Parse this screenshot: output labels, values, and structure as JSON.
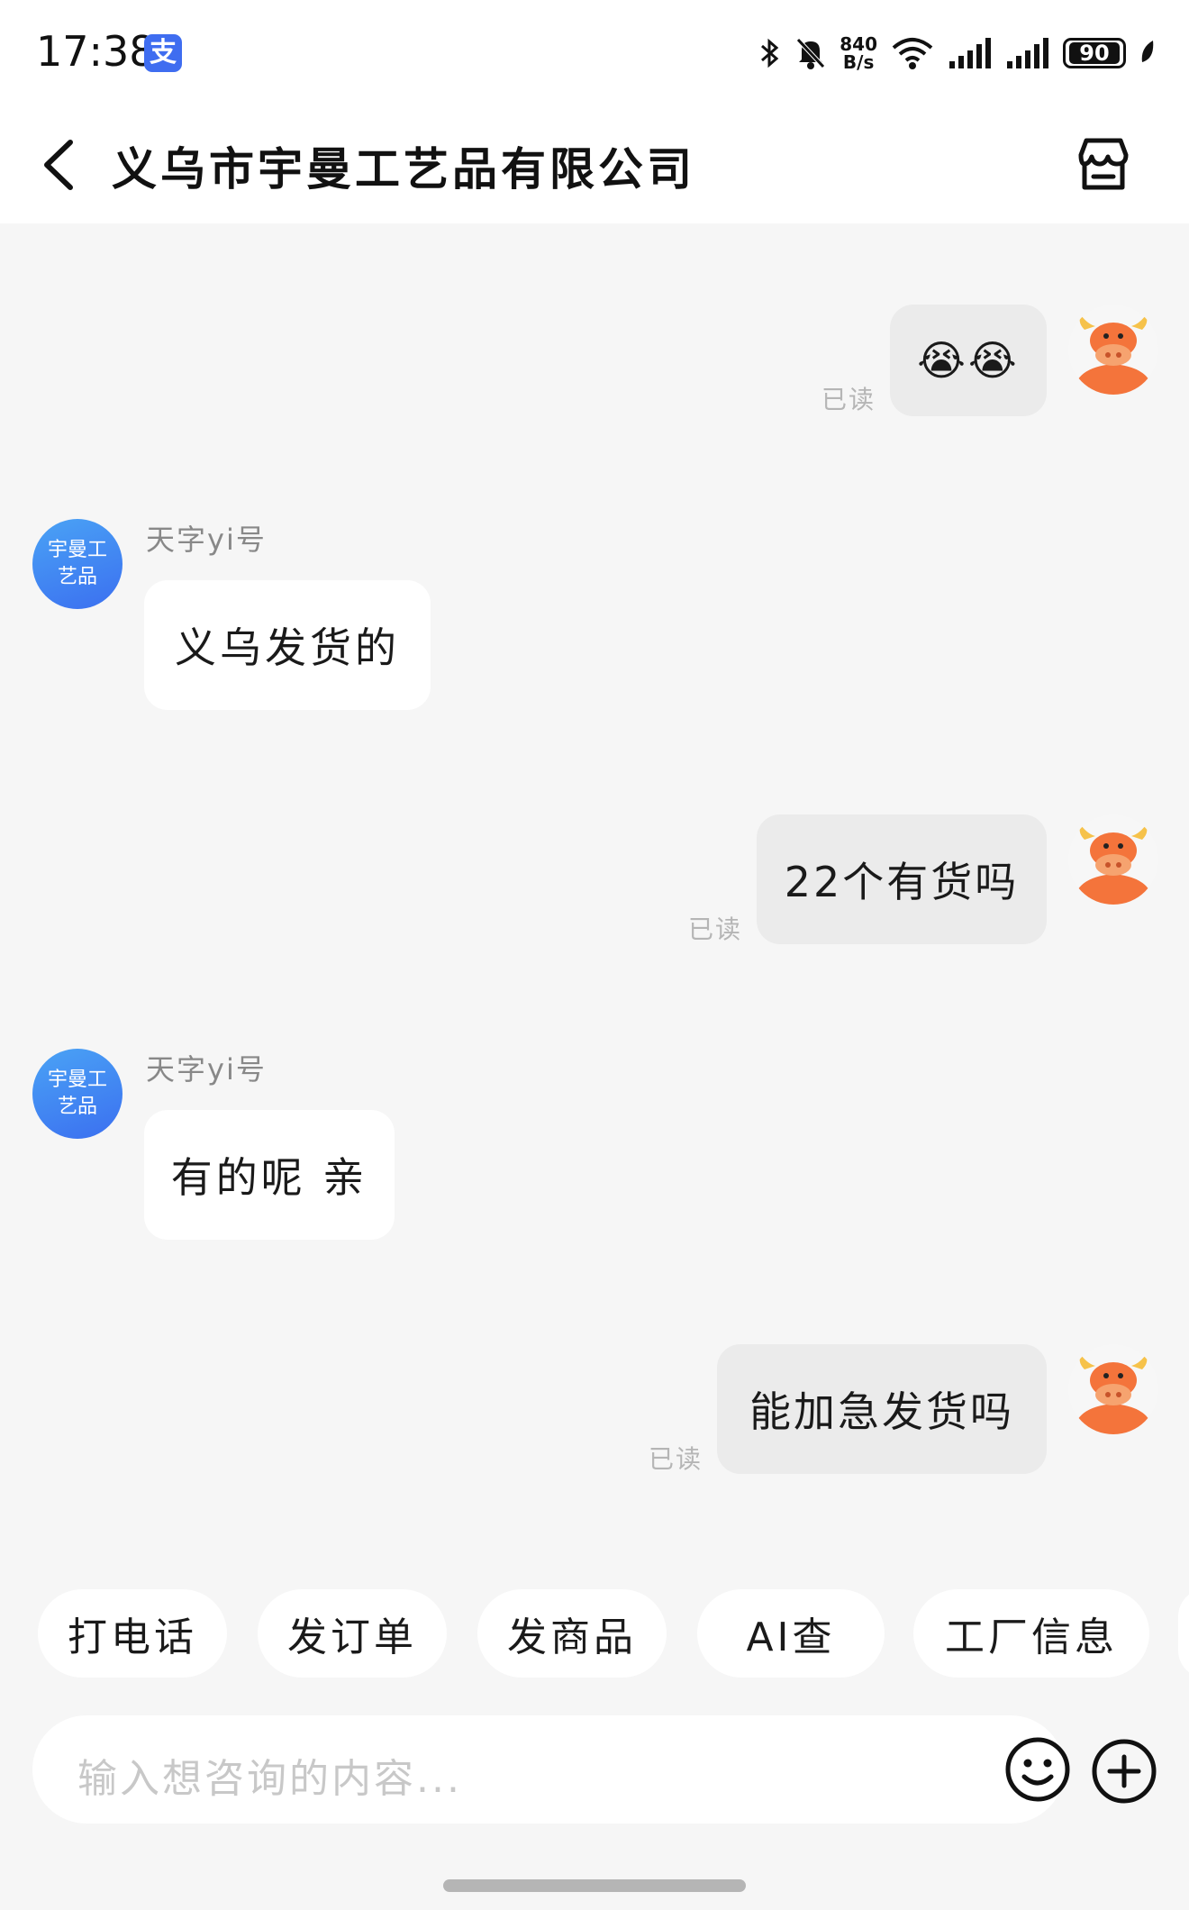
{
  "status_bar": {
    "time": "17:38",
    "alipay_glyph": "支",
    "net_speed_value": "840",
    "net_speed_unit": "B/s",
    "battery": "90"
  },
  "header": {
    "title": "义乌市宇曼工艺品有限公司",
    "back_icon": "chevron-left-icon",
    "shop_icon": "storefront-icon"
  },
  "messages": [
    {
      "direction": "out",
      "text": "😭😭",
      "read": "已读"
    },
    {
      "direction": "in",
      "sender": "天字yi号",
      "avatar_text": [
        "宇曼工",
        "艺品"
      ],
      "text": "义乌发货的"
    },
    {
      "direction": "out",
      "text": "22个有货吗",
      "read": "已读"
    },
    {
      "direction": "in",
      "sender": "天字yi号",
      "avatar_text": [
        "宇曼工",
        "艺品"
      ],
      "text": "有的呢 亲"
    },
    {
      "direction": "out",
      "text": "能加急发货吗",
      "read": "已读"
    }
  ],
  "quick_actions": [
    "打电话",
    "发订单",
    "发商品",
    "AI查",
    "工厂信息"
  ],
  "composer": {
    "placeholder": "输入想咨询的内容...",
    "emoji_icon": "smiley-icon",
    "plus_icon": "plus-circle-icon"
  },
  "colors": {
    "background": "#f6f6f6",
    "outgoing_bubble": "#ebebeb",
    "incoming_bubble": "#ffffff",
    "shop_avatar": "#3b6ff0",
    "bull_orange": "#f4743b"
  }
}
